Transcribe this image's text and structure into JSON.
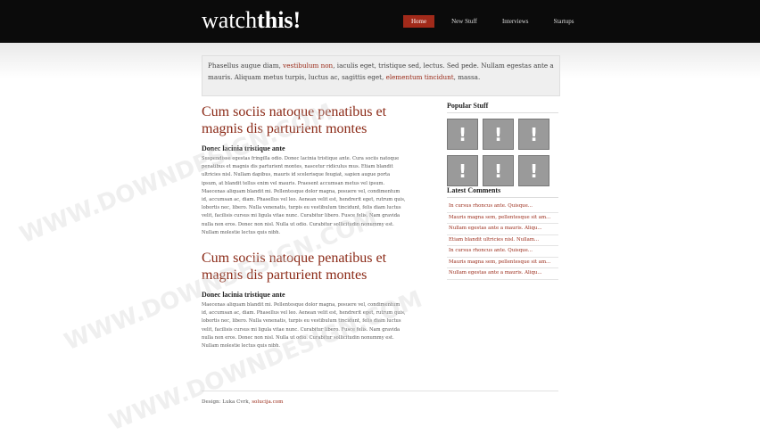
{
  "header": {
    "logo_light": "watch",
    "logo_bold": "this!",
    "nav": [
      {
        "label": "Home",
        "active": true
      },
      {
        "label": "New Stuff",
        "active": false
      },
      {
        "label": "Interviews",
        "active": false
      },
      {
        "label": "Startups",
        "active": false
      }
    ]
  },
  "intro": {
    "text1": "Phasellus augue diam, ",
    "link1": "vestibulum non",
    "text2": ", iaculis eget, tristique sed, lectus. Sed pede. Nullam egestas ante a mauris. Aliquam metus turpis, luctus ac, sagittis eget, ",
    "link2": "elementum tincidunt",
    "text3": ", massa."
  },
  "posts": [
    {
      "title": "Cum sociis natoque penatibus et magnis dis parturient montes",
      "subtitle": "Donec lacinia tristique ante",
      "body": "Suspendisse egestas fringilla odio. Donec lacinia tristique ante. Cura sociis natoque penatibus et magnis dis parturient montes, nascetur ridiculus mus. Etiam blandit ultricies nisl. Nullam dapibus, mauris id scelerisque feugiat, sapien augue porta ipsum, at blandit tellus enim vel mauris. Praesent accumsan metus vel ipsum. Maecenas aliquam blandit mi. Pellentesque dolor magna, posuere vel, condimentum id, accumsan ac, diam. Phasellus vel leo. Aenean velit est, hendrerit eget, rutrum quis, lobortis nec, libero. Nulla venenatis, turpis eu vestibulum tincidunt, felis diam luctus velit, facilisis cursus mi ligula vitae nunc. Curabitur libero. Fusce felis. Nam gravida nulla non eros. Donec non nisl. Nulla ut odio. Curabitur sollicitudin nonummy est. Nullam molestie lectus quis nibh."
    },
    {
      "title": "Cum sociis natoque penatibus et magnis dis parturient montes",
      "subtitle": "Donec lacinia tristique ante",
      "body": "Maecenas aliquam blandit mi. Pellentesque dolor magna, posuere vel, condimentum id, accumsan ac, diam. Phasellus vel leo. Aenean velit est, hendrerit eget, rutrum quis, lobortis nec, libero. Nulla venenatis, turpis eu vestibulum tincidunt, felis diam luctus velit, facilisis cursus mi ligula vitae nunc. Curabitur libero. Fusce felis. Nam gravida nulla non eros. Donec non nisl. Nulla ut odio. Curabitur sollicitudin nonummy est. Nullam molestie lectus quis nibh."
    }
  ],
  "sidebar": {
    "popular_title": "Popular Stuff",
    "thumb_icon": "!",
    "latest_title": "Latest Comments",
    "comments": [
      "In cursus rhoncus ante. Quisque...",
      "Mauris magna sem, pellentesque sit am...",
      "Nullam egestas ante a mauris. Aliqu...",
      "Etiam blandit ultricies nisl. Nullam...",
      "In cursus rhoncus ante. Quisque...",
      "Mauris magna sem, pellentesque sit am...",
      "Nullam egestas ante a mauris. Aliqu..."
    ]
  },
  "footer": {
    "text": "Design: Luka Cvrk, ",
    "link": "solucija.com"
  },
  "watermark": "WWW.DOWNDESIGN.COM",
  "colors": {
    "accent": "#9a2a18",
    "topbar": "#0b0b0b",
    "nav_active": "#a12a1a"
  }
}
